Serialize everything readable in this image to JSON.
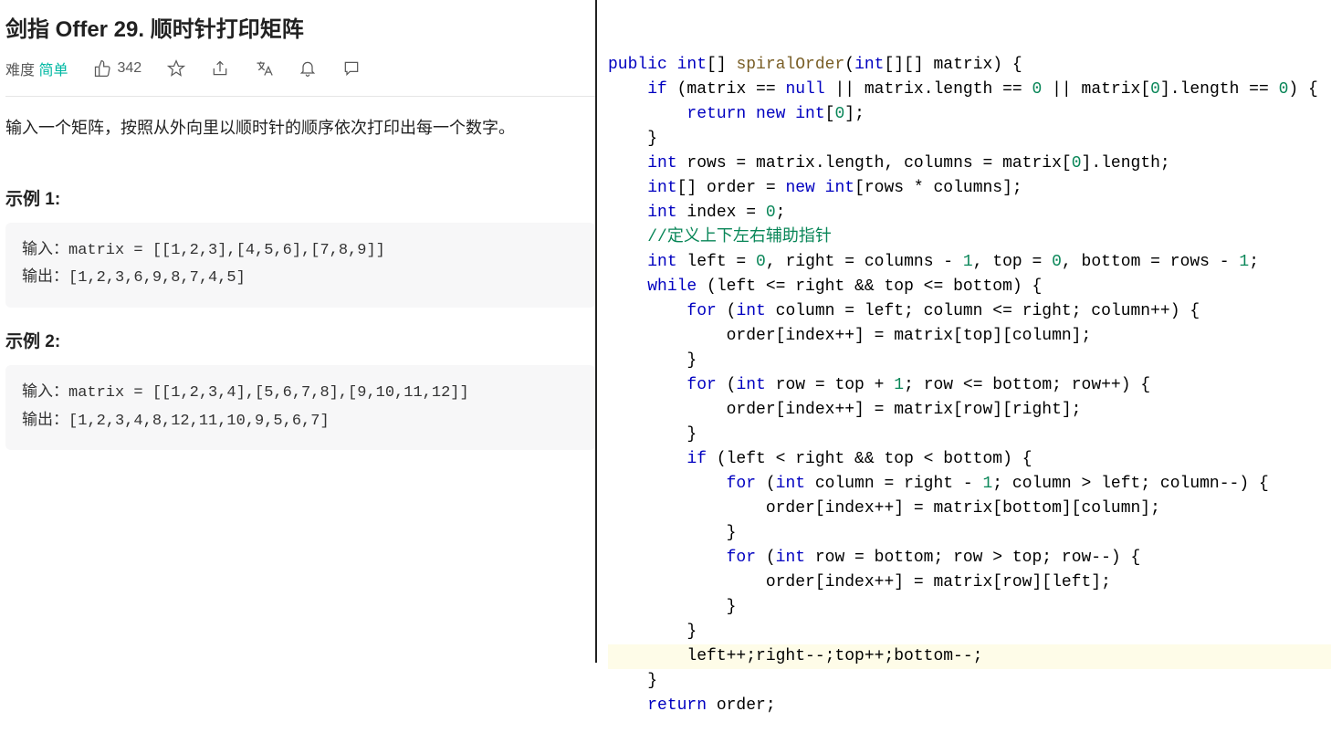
{
  "problem": {
    "title": "剑指 Offer 29. 顺时针打印矩阵",
    "difficulty_label": "难度",
    "difficulty_value": "简单",
    "likes": "342",
    "description": "输入一个矩阵，按照从外向里以顺时针的顺序依次打印出每一个数字。",
    "examples": [
      {
        "heading": "示例 1:",
        "input_label": "输入：",
        "input_value": "matrix = [[1,2,3],[4,5,6],[7,8,9]]",
        "output_label": "输出：",
        "output_value": "[1,2,3,6,9,8,7,4,5]"
      },
      {
        "heading": "示例 2:",
        "input_label": "输入：",
        "input_value": "matrix = [[1,2,3,4],[5,6,7,8],[9,10,11,12]]",
        "output_label": "输出：",
        "output_value": "[1,2,3,4,8,12,11,10,9,5,6,7]"
      }
    ]
  },
  "code": {
    "tokens": [
      [
        {
          "t": "public ",
          "c": "kw"
        },
        {
          "t": "int",
          "c": "type"
        },
        {
          "t": "[] "
        },
        {
          "t": "spiralOrder",
          "c": "fn"
        },
        {
          "t": "("
        },
        {
          "t": "int",
          "c": "type"
        },
        {
          "t": "[][] matrix) {"
        }
      ],
      [
        {
          "t": "    "
        },
        {
          "t": "if",
          "c": "kw"
        },
        {
          "t": " (matrix == "
        },
        {
          "t": "null",
          "c": "kw"
        },
        {
          "t": " || matrix.length == "
        },
        {
          "t": "0",
          "c": "num"
        },
        {
          "t": " || matrix["
        },
        {
          "t": "0",
          "c": "num"
        },
        {
          "t": "].length == "
        },
        {
          "t": "0",
          "c": "num"
        },
        {
          "t": ") {"
        }
      ],
      [
        {
          "t": "        "
        },
        {
          "t": "return new ",
          "c": "kw"
        },
        {
          "t": "int",
          "c": "type"
        },
        {
          "t": "["
        },
        {
          "t": "0",
          "c": "num"
        },
        {
          "t": "];"
        }
      ],
      [
        {
          "t": "    }"
        }
      ],
      [
        {
          "t": "    "
        },
        {
          "t": "int",
          "c": "type"
        },
        {
          "t": " rows = matrix.length, columns = matrix["
        },
        {
          "t": "0",
          "c": "num"
        },
        {
          "t": "].length;"
        }
      ],
      [
        {
          "t": "    "
        },
        {
          "t": "int",
          "c": "type"
        },
        {
          "t": "[] order = "
        },
        {
          "t": "new ",
          "c": "kw"
        },
        {
          "t": "int",
          "c": "type"
        },
        {
          "t": "[rows * columns];"
        }
      ],
      [
        {
          "t": "    "
        },
        {
          "t": "int",
          "c": "type"
        },
        {
          "t": " index = "
        },
        {
          "t": "0",
          "c": "num"
        },
        {
          "t": ";"
        }
      ],
      [
        {
          "t": "    "
        },
        {
          "t": "//定义上下左右辅助指针",
          "c": "str-comment"
        }
      ],
      [
        {
          "t": "    "
        },
        {
          "t": "int",
          "c": "type"
        },
        {
          "t": " left = "
        },
        {
          "t": "0",
          "c": "num"
        },
        {
          "t": ", right = columns - "
        },
        {
          "t": "1",
          "c": "num"
        },
        {
          "t": ", top = "
        },
        {
          "t": "0",
          "c": "num"
        },
        {
          "t": ", bottom = rows - "
        },
        {
          "t": "1",
          "c": "num"
        },
        {
          "t": ";"
        }
      ],
      [
        {
          "t": "    "
        },
        {
          "t": "while",
          "c": "kw"
        },
        {
          "t": " (left <= right && top <= bottom) {"
        }
      ],
      [
        {
          "t": "        "
        },
        {
          "t": "for",
          "c": "kw"
        },
        {
          "t": " ("
        },
        {
          "t": "int",
          "c": "type"
        },
        {
          "t": " column = left; column <= right; column++) {"
        }
      ],
      [
        {
          "t": "            order[index++] = matrix[top][column];"
        }
      ],
      [
        {
          "t": "        }"
        }
      ],
      [
        {
          "t": "        "
        },
        {
          "t": "for",
          "c": "kw"
        },
        {
          "t": " ("
        },
        {
          "t": "int",
          "c": "type"
        },
        {
          "t": " row = top + "
        },
        {
          "t": "1",
          "c": "num"
        },
        {
          "t": "; row <= bottom; row++) {"
        }
      ],
      [
        {
          "t": "            order[index++] = matrix[row][right];"
        }
      ],
      [
        {
          "t": "        }"
        }
      ],
      [
        {
          "t": "        "
        },
        {
          "t": "if",
          "c": "kw"
        },
        {
          "t": " (left < right && top < bottom) {"
        }
      ],
      [
        {
          "t": "            "
        },
        {
          "t": "for",
          "c": "kw"
        },
        {
          "t": " ("
        },
        {
          "t": "int",
          "c": "type"
        },
        {
          "t": " column = right - "
        },
        {
          "t": "1",
          "c": "num"
        },
        {
          "t": "; column > left; column--) {"
        }
      ],
      [
        {
          "t": "                order[index++] = matrix[bottom][column];"
        }
      ],
      [
        {
          "t": "            }"
        }
      ],
      [
        {
          "t": "            "
        },
        {
          "t": "for",
          "c": "kw"
        },
        {
          "t": " ("
        },
        {
          "t": "int",
          "c": "type"
        },
        {
          "t": " row = bottom; row > top; row--) {"
        }
      ],
      [
        {
          "t": "                order[index++] = matrix[row][left];"
        }
      ],
      [
        {
          "t": "            }"
        }
      ],
      [
        {
          "t": "        }"
        }
      ],
      [
        {
          "t": "        left++;right--;top++;bottom--;",
          "hl": true
        }
      ],
      [
        {
          "t": "    }"
        }
      ],
      [
        {
          "t": "    "
        },
        {
          "t": "return",
          "c": "kw"
        },
        {
          "t": " order;"
        }
      ]
    ]
  }
}
